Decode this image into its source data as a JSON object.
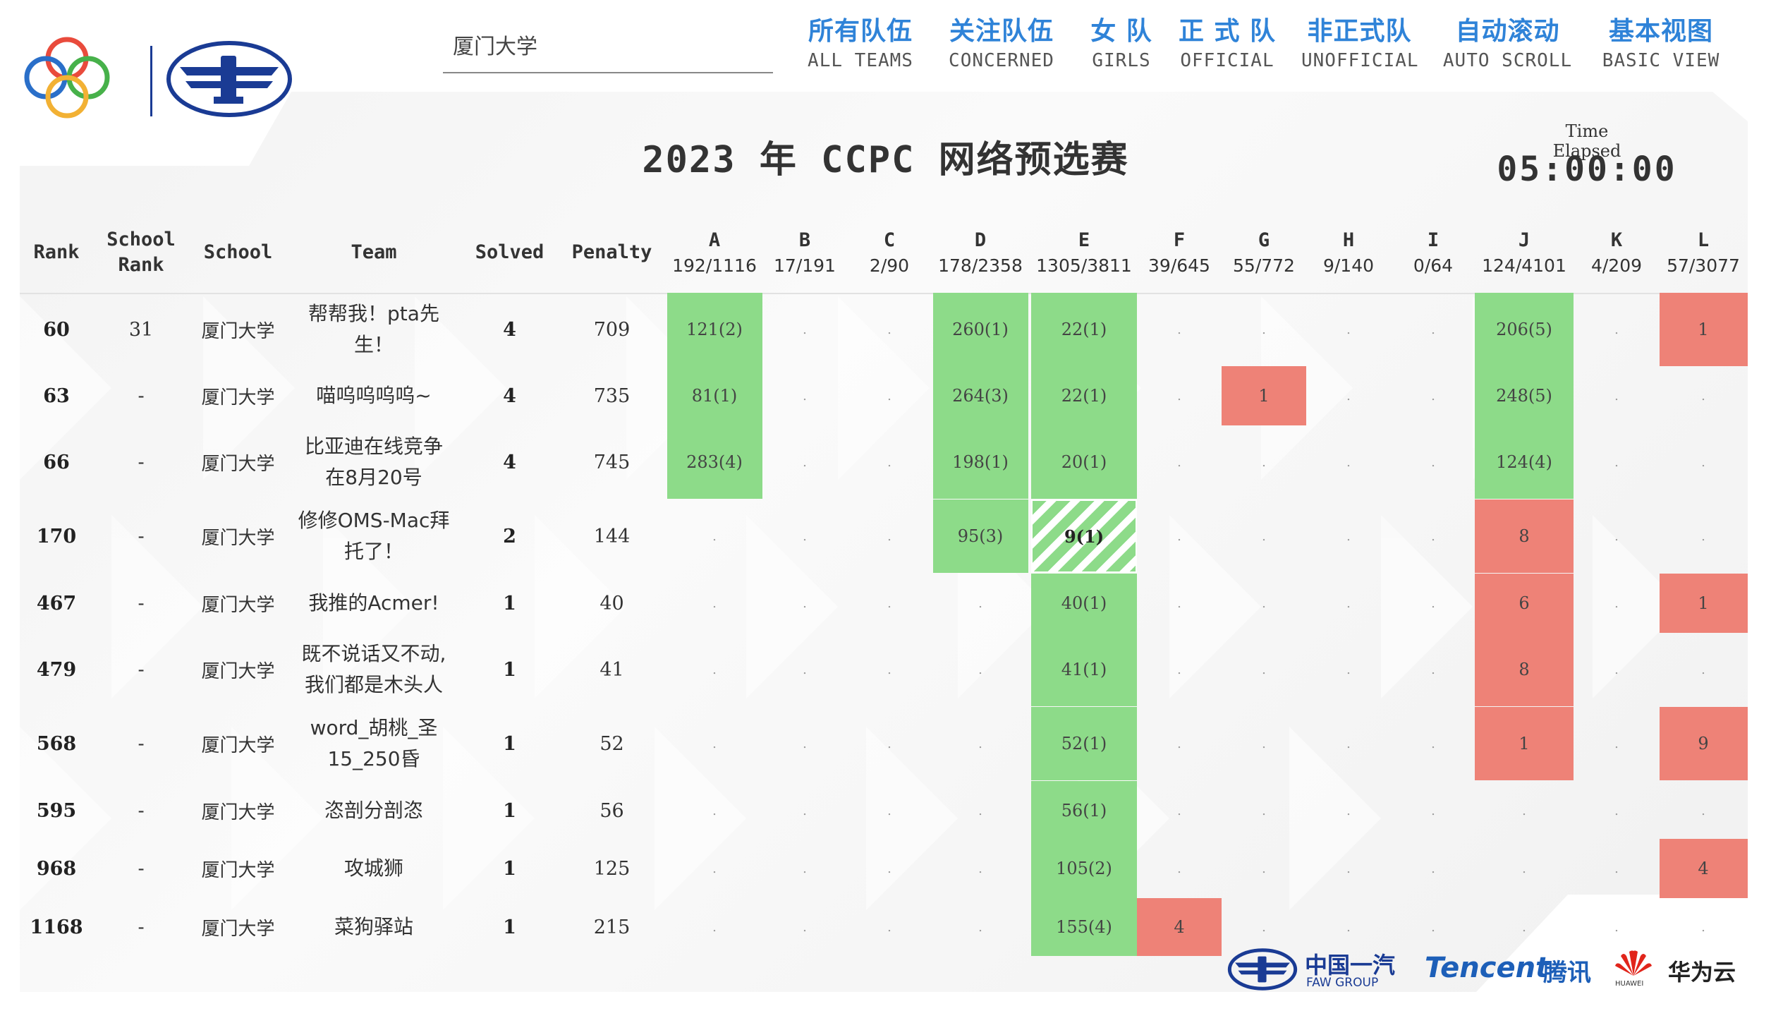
{
  "search": {
    "value": "厦门大学",
    "placeholder": ""
  },
  "nav": [
    {
      "cn": "所有队伍",
      "en": "ALL TEAMS"
    },
    {
      "cn": "关注队伍",
      "en": "CONCERNED"
    },
    {
      "cn": "女 队",
      "en": "GIRLS"
    },
    {
      "cn": "正 式 队",
      "en": "OFFICIAL"
    },
    {
      "cn": "非正式队",
      "en": "UNOFFICIAL"
    },
    {
      "cn": "自动滚动",
      "en": "AUTO SCROLL"
    },
    {
      "cn": "基本视图",
      "en": "BASIC VIEW"
    }
  ],
  "title": "2023 年 CCPC 网络预选赛",
  "time": {
    "label": "Time Elapsed",
    "value": "05:00:00"
  },
  "columns": {
    "rank": "Rank",
    "school_rank_1": "School",
    "school_rank_2": "Rank",
    "school": "School",
    "team": "Team",
    "solved": "Solved",
    "penalty": "Penalty"
  },
  "problems": [
    {
      "letter": "A",
      "stat": "192/1116"
    },
    {
      "letter": "B",
      "stat": "17/191"
    },
    {
      "letter": "C",
      "stat": "2/90"
    },
    {
      "letter": "D",
      "stat": "178/2358"
    },
    {
      "letter": "E",
      "stat": "1305/3811"
    },
    {
      "letter": "F",
      "stat": "39/645"
    },
    {
      "letter": "G",
      "stat": "55/772"
    },
    {
      "letter": "H",
      "stat": "9/140"
    },
    {
      "letter": "I",
      "stat": "0/64"
    },
    {
      "letter": "J",
      "stat": "124/4101"
    },
    {
      "letter": "K",
      "stat": "4/209"
    },
    {
      "letter": "L",
      "stat": "57/3077"
    }
  ],
  "rows": [
    {
      "rank": "60",
      "school_rank": "31",
      "school": "厦门大学",
      "team": [
        "帮帮我！pta先",
        "生！"
      ],
      "solved": "4",
      "penalty": "709",
      "cells": [
        [
          "ac",
          "121(2)"
        ],
        [
          "e",
          "."
        ],
        [
          "e",
          "."
        ],
        [
          "ac",
          "260(1)"
        ],
        [
          "ac",
          "22(1)"
        ],
        [
          "e",
          "."
        ],
        [
          "e",
          "."
        ],
        [
          "e",
          "."
        ],
        [
          "e",
          "."
        ],
        [
          "ac",
          "206(5)"
        ],
        [
          "e",
          "."
        ],
        [
          "wa",
          "1"
        ]
      ]
    },
    {
      "rank": "63",
      "school_rank": "-",
      "school": "厦门大学",
      "team": [
        "喵呜呜呜呜~"
      ],
      "solved": "4",
      "penalty": "735",
      "cells": [
        [
          "ac",
          "81(1)"
        ],
        [
          "e",
          "."
        ],
        [
          "e",
          "."
        ],
        [
          "ac",
          "264(3)"
        ],
        [
          "ac",
          "22(1)"
        ],
        [
          "e",
          "."
        ],
        [
          "wa",
          "1"
        ],
        [
          "e",
          "."
        ],
        [
          "e",
          "."
        ],
        [
          "ac",
          "248(5)"
        ],
        [
          "e",
          "."
        ],
        [
          "e",
          "."
        ]
      ]
    },
    {
      "rank": "66",
      "school_rank": "-",
      "school": "厦门大学",
      "team": [
        "比亚迪在线竞争",
        "在8月20号"
      ],
      "solved": "4",
      "penalty": "745",
      "cells": [
        [
          "ac",
          "283(4)"
        ],
        [
          "e",
          "."
        ],
        [
          "e",
          "."
        ],
        [
          "ac",
          "198(1)"
        ],
        [
          "ac",
          "20(1)"
        ],
        [
          "e",
          "."
        ],
        [
          "e",
          "."
        ],
        [
          "e",
          "."
        ],
        [
          "e",
          "."
        ],
        [
          "ac",
          "124(4)"
        ],
        [
          "e",
          "."
        ],
        [
          "e",
          "."
        ]
      ]
    },
    {
      "rank": "170",
      "school_rank": "-",
      "school": "厦门大学",
      "team": [
        "修修OMS-Mac拜",
        "托了！"
      ],
      "solved": "2",
      "penalty": "144",
      "cells": [
        [
          "e",
          "."
        ],
        [
          "e",
          "."
        ],
        [
          "e",
          "."
        ],
        [
          "ac",
          "95(3)"
        ],
        [
          "pd",
          "9(1)"
        ],
        [
          "e",
          "."
        ],
        [
          "e",
          "."
        ],
        [
          "e",
          "."
        ],
        [
          "e",
          "."
        ],
        [
          "wa",
          "8"
        ],
        [
          "e",
          "."
        ],
        [
          "e",
          "."
        ]
      ]
    },
    {
      "rank": "467",
      "school_rank": "-",
      "school": "厦门大学",
      "team": [
        "我推的Acmer!"
      ],
      "solved": "1",
      "penalty": "40",
      "cells": [
        [
          "e",
          "."
        ],
        [
          "e",
          "."
        ],
        [
          "e",
          "."
        ],
        [
          "e",
          "."
        ],
        [
          "ac",
          "40(1)"
        ],
        [
          "e",
          "."
        ],
        [
          "e",
          "."
        ],
        [
          "e",
          "."
        ],
        [
          "e",
          "."
        ],
        [
          "wa",
          "6"
        ],
        [
          "e",
          "."
        ],
        [
          "wa",
          "1"
        ]
      ]
    },
    {
      "rank": "479",
      "school_rank": "-",
      "school": "厦门大学",
      "team": [
        "既不说话又不动,",
        "我们都是木头人"
      ],
      "solved": "1",
      "penalty": "41",
      "cells": [
        [
          "e",
          "."
        ],
        [
          "e",
          "."
        ],
        [
          "e",
          "."
        ],
        [
          "e",
          "."
        ],
        [
          "ac",
          "41(1)"
        ],
        [
          "e",
          "."
        ],
        [
          "e",
          "."
        ],
        [
          "e",
          "."
        ],
        [
          "e",
          "."
        ],
        [
          "wa",
          "8"
        ],
        [
          "e",
          "."
        ],
        [
          "e",
          "."
        ]
      ]
    },
    {
      "rank": "568",
      "school_rank": "-",
      "school": "厦门大学",
      "team": [
        "word_胡桃_圣",
        "15_250昏"
      ],
      "solved": "1",
      "penalty": "52",
      "cells": [
        [
          "e",
          "."
        ],
        [
          "e",
          "."
        ],
        [
          "e",
          "."
        ],
        [
          "e",
          "."
        ],
        [
          "ac",
          "52(1)"
        ],
        [
          "e",
          "."
        ],
        [
          "e",
          "."
        ],
        [
          "e",
          "."
        ],
        [
          "e",
          "."
        ],
        [
          "wa",
          "1"
        ],
        [
          "e",
          "."
        ],
        [
          "wa",
          "9"
        ]
      ]
    },
    {
      "rank": "595",
      "school_rank": "-",
      "school": "厦门大学",
      "team": [
        "恣剖分剖恣"
      ],
      "solved": "1",
      "penalty": "56",
      "cells": [
        [
          "e",
          "."
        ],
        [
          "e",
          "."
        ],
        [
          "e",
          "."
        ],
        [
          "e",
          "."
        ],
        [
          "ac",
          "56(1)"
        ],
        [
          "e",
          "."
        ],
        [
          "e",
          "."
        ],
        [
          "e",
          "."
        ],
        [
          "e",
          "."
        ],
        [
          "e",
          "."
        ],
        [
          "e",
          "."
        ],
        [
          "e",
          "."
        ]
      ]
    },
    {
      "rank": "968",
      "school_rank": "-",
      "school": "厦门大学",
      "team": [
        "攻城狮"
      ],
      "solved": "1",
      "penalty": "125",
      "cells": [
        [
          "e",
          "."
        ],
        [
          "e",
          "."
        ],
        [
          "e",
          "."
        ],
        [
          "e",
          "."
        ],
        [
          "ac",
          "105(2)"
        ],
        [
          "e",
          "."
        ],
        [
          "e",
          "."
        ],
        [
          "e",
          "."
        ],
        [
          "e",
          "."
        ],
        [
          "e",
          "."
        ],
        [
          "e",
          "."
        ],
        [
          "wa",
          "4"
        ]
      ]
    },
    {
      "rank": "1168",
      "school_rank": "-",
      "school": "厦门大学",
      "team": [
        "菜狗驿站"
      ],
      "solved": "1",
      "penalty": "215",
      "cells": [
        [
          "e",
          "."
        ],
        [
          "e",
          "."
        ],
        [
          "e",
          "."
        ],
        [
          "e",
          "."
        ],
        [
          "ac",
          "155(4)"
        ],
        [
          "wa",
          "4"
        ],
        [
          "e",
          "."
        ],
        [
          "e",
          "."
        ],
        [
          "e",
          "."
        ],
        [
          "e",
          "."
        ],
        [
          "e",
          "."
        ],
        [
          "e",
          "."
        ]
      ]
    }
  ],
  "sponsors": {
    "faw_cn": "中国一汽",
    "faw_en": "FAW GROUP",
    "tencent_en": "Tencent",
    "tencent_cn": "腾讯",
    "huawei_label": "HUAWEI",
    "huawei_cloud": "华为云"
  },
  "colors": {
    "accepted": "#8ddb89",
    "rejected": "#ee8277",
    "nav": "#2f83d8",
    "logo_blue": "#1a3b94"
  }
}
